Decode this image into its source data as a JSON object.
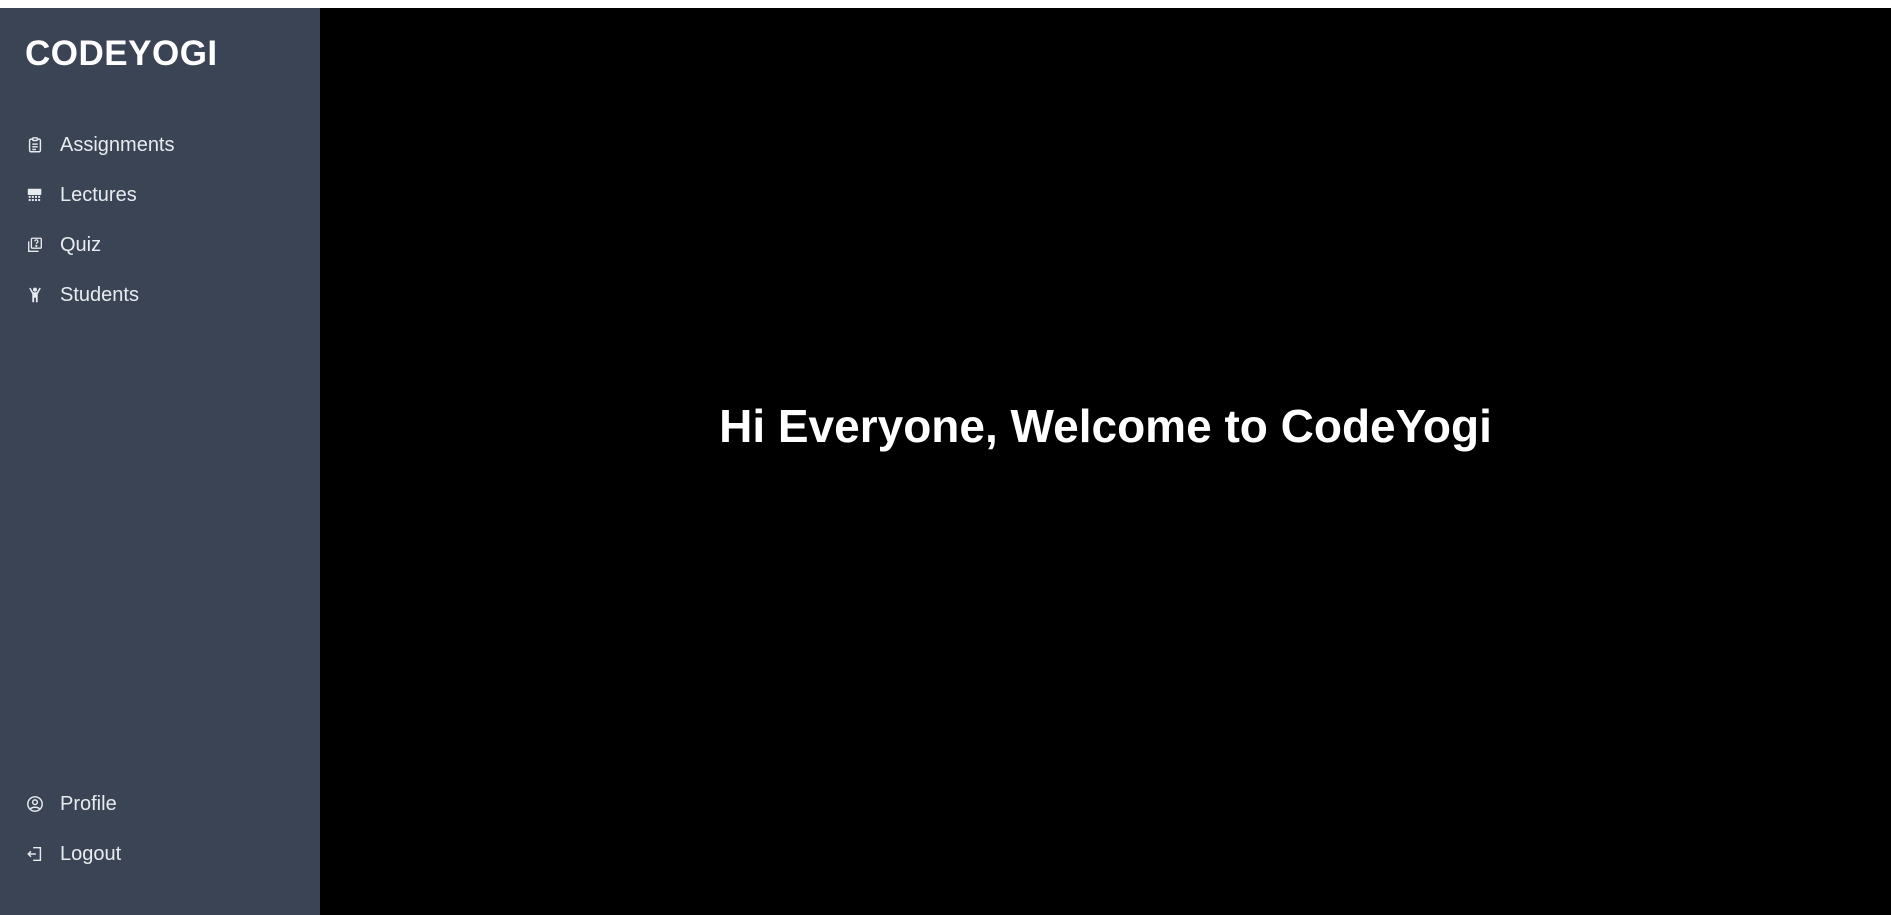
{
  "sidebar": {
    "brand": "CODEYOGI",
    "nav_top": [
      {
        "label": "Assignments",
        "icon": "clipboard-icon"
      },
      {
        "label": "Lectures",
        "icon": "lectures-icon"
      },
      {
        "label": "Quiz",
        "icon": "quiz-icon"
      },
      {
        "label": "Students",
        "icon": "student-icon"
      }
    ],
    "nav_bottom": [
      {
        "label": "Profile",
        "icon": "user-circle-icon"
      },
      {
        "label": "Logout",
        "icon": "logout-icon"
      }
    ]
  },
  "main": {
    "heading": "Hi Everyone, Welcome to CodeYogi"
  },
  "colors": {
    "sidebar_bg": "#3b4455",
    "main_bg": "#000000",
    "text": "#ffffff"
  }
}
